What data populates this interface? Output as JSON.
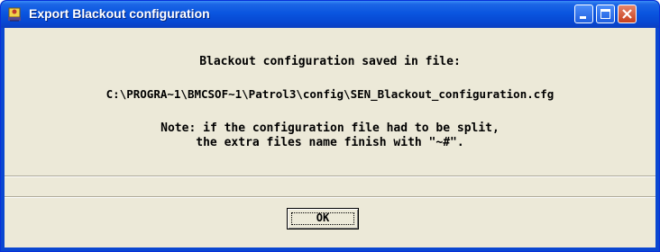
{
  "window": {
    "title": "Export Blackout configuration",
    "icon": "app-icon",
    "controls": [
      "minimize-icon",
      "maximize-icon",
      "close-icon"
    ]
  },
  "message": {
    "line1": "Blackout configuration saved in file:",
    "path": "C:\\PROGRA~1\\BMCSOF~1\\Patrol3\\config\\SEN_Blackout_configuration.cfg",
    "note_line1": "Note: if the configuration file had to be split,",
    "note_line2": "the extra files name finish with \"~#\"."
  },
  "buttons": {
    "ok_label": "OK"
  },
  "colors": {
    "titlebar": "#0a55df",
    "client_bg": "#ece9d8",
    "close_button": "#c8401d"
  }
}
